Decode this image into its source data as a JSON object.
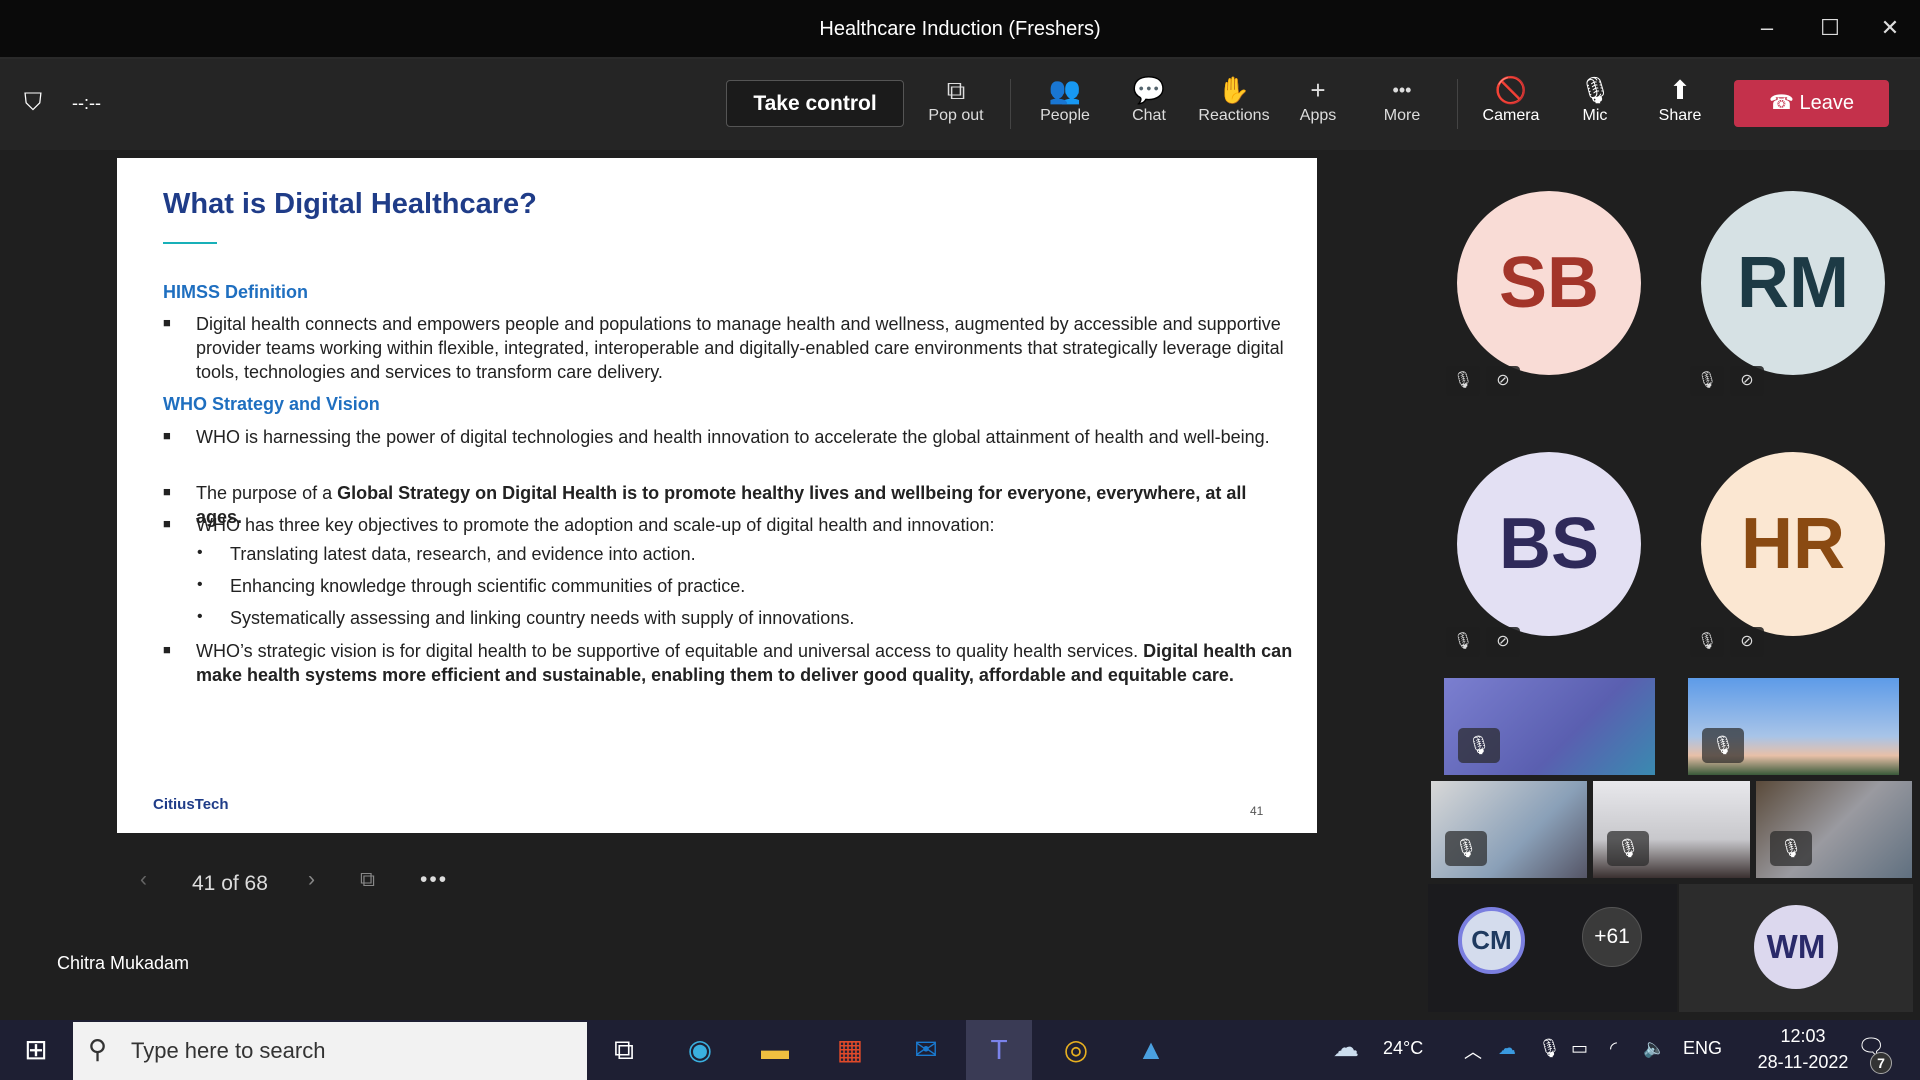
{
  "window": {
    "title": "Healthcare Induction (Freshers)",
    "minimize": "–",
    "maximize": "☐",
    "close": "✕"
  },
  "toolbar": {
    "timer": "--:--",
    "take_control": "Take control",
    "items": [
      {
        "label": "Pop out",
        "icon": "⧉"
      },
      {
        "label": "People",
        "icon": "👥"
      },
      {
        "label": "Chat",
        "icon": "💬"
      },
      {
        "label": "Reactions",
        "icon": "✋"
      },
      {
        "label": "Apps",
        "icon": "+"
      },
      {
        "label": "More",
        "icon": "•••"
      },
      {
        "label": "Camera",
        "icon": "🚫"
      },
      {
        "label": "Mic",
        "icon": "🎙"
      },
      {
        "label": "Share",
        "icon": "⬆"
      }
    ],
    "leave": "Leave"
  },
  "slide": {
    "title": "What is Digital Healthcare?",
    "section1": "HIMSS Definition",
    "p1": "Digital health connects and empowers people and populations to manage health and wellness, augmented by accessible and supportive provider teams working within flexible, integrated, interoperable and digitally-enabled care environments that strategically leverage digital tools, technologies and services to transform care delivery.",
    "section2": "WHO Strategy and Vision",
    "p2": "WHO is harnessing the power of digital technologies and health innovation to accelerate the global attainment of health and well-being.",
    "p3_a": "The purpose of a ",
    "p3_b": "Global Strategy on Digital Health is to promote healthy lives and wellbeing for everyone, everywhere, at all ages.",
    "p4": "WHO has three key objectives to promote the adoption and scale-up of digital health and innovation:",
    "sub": [
      "Translating latest data, research, and evidence into action.",
      "Enhancing knowledge through scientific communities of practice.",
      "Systematically assessing and linking country needs with supply of innovations."
    ],
    "p5_a": "WHO’s strategic vision is for digital health to be supportive of equitable and universal access to quality health services. ",
    "p5_b": "Digital health can make health systems more efficient and sustainable, enabling them to deliver good quality, affordable and equitable care.",
    "logo": "CitiusTech",
    "page": "41"
  },
  "slide_nav": {
    "position": "41 of 68"
  },
  "presenter": "Chitra Mukadam",
  "participants": [
    {
      "initials": "SB",
      "bg": "#f9dcd6",
      "fg": "#a3352a"
    },
    {
      "initials": "RM",
      "bg": "#d6e1e4",
      "fg": "#1d3a45"
    },
    {
      "initials": "BS",
      "bg": "#e3e0f3",
      "fg": "#2f2a5a"
    },
    {
      "initials": "HR",
      "bg": "#fbe7d2",
      "fg": "#8a4a12"
    }
  ],
  "bottom": {
    "cm": "CM",
    "overflow": "+61",
    "wm": "WM"
  },
  "taskbar": {
    "search_placeholder": "Type here to search",
    "weather": "24°C",
    "lang": "ENG",
    "time": "12:03",
    "date": "28-11-2022",
    "notifications": "7"
  }
}
